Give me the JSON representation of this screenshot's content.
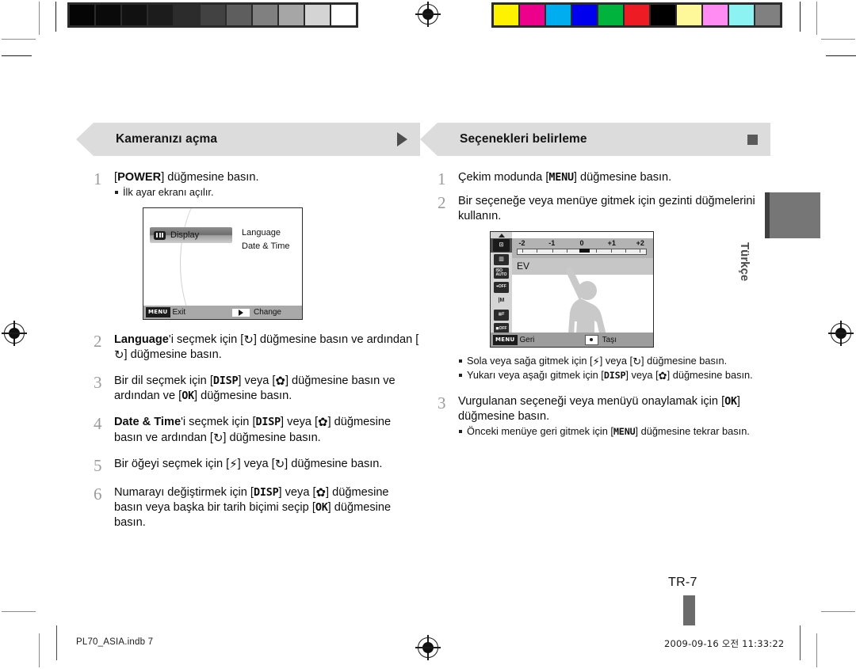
{
  "document": {
    "language_tab": "Türkçe",
    "page_number": "TR-7",
    "footer_file": "PL70_ASIA.indb   7",
    "footer_date": "2009-09-16   오전 11:33:22"
  },
  "calibration": {
    "gray_strip_label": "grayscale-calibration-strip",
    "gray_swatches": [
      "#050505",
      "#0a0a0a",
      "#111111",
      "#1c1c1c",
      "#2c2c2c",
      "#424242",
      "#5e5e5e",
      "#808080",
      "#a6a6a6",
      "#d4d4d4",
      "#ffffff"
    ],
    "color_strip_label": "color-calibration-strip",
    "color_swatches": [
      "#fff200",
      "#ec008c",
      "#00aeef",
      "#0000ee",
      "#00b33c",
      "#ed1c24",
      "#000000",
      "#fff89a",
      "#ff8cf2",
      "#8cf2f2",
      "#808080"
    ]
  },
  "left_section": {
    "heading": "Kameranızı açma",
    "marker": "triangle-right",
    "steps": [
      {
        "num": "1",
        "text_html": "[<b>POWER</b>] düğmesine basın.",
        "bullets": [
          "İlk ayar ekranı açılır."
        ]
      },
      {
        "num": "2",
        "text_html": "<b>Language</b>'i seçmek için [<span class=\"glyph\">↻</span>] düğmesine basın ve ardından [<span class=\"glyph\">↻</span>] düğmesine basın."
      },
      {
        "num": "3",
        "text_html": "Bir dil seçmek için [<span class=\"key\">DISP</span>] veya [<span class=\"glyph\">✿</span>] düğmesine basın ve ardından ve [<span class=\"key\">OK</span>] düğmesine basın."
      },
      {
        "num": "4",
        "text_html": "<b>Date &amp; Time</b>'i seçmek için [<span class=\"key\">DISP</span>] veya [<span class=\"glyph\">✿</span>] düğmesine basın ve ardından [<span class=\"glyph\">↻</span>] düğmesine basın."
      },
      {
        "num": "5",
        "text_html": "Bir öğeyi seçmek için [<span class=\"glyph\">⚡</span>] veya [<span class=\"glyph\">↻</span>] düğmesine basın."
      },
      {
        "num": "6",
        "text_html": "Numarayı değiştirmek için [<span class=\"key\">DISP</span>] veya [<span class=\"glyph\">✿</span>] düğmesine basın veya başka bir tarih biçimi seçip [<span class=\"key\">OK</span>] düğmesine basın."
      }
    ],
    "lcd_setup": {
      "selected_item": "Display",
      "selected_icon": "display-icon",
      "menu_items": [
        "Language",
        "Date & Time"
      ],
      "bottom_bar": {
        "menu_badge": "MENU",
        "left_label": "Exit",
        "arrow_icon": "triangle-right-icon",
        "right_label": "Change"
      }
    }
  },
  "right_section": {
    "heading": "Seçenekleri belirleme",
    "marker": "square",
    "steps": [
      {
        "num": "1",
        "text_html": "Çekim modunda [<span class=\"key\">MENU</span>] düğmesine basın."
      },
      {
        "num": "2",
        "text_html": "Bir seçeneğe veya menüye gitmek için gezinti düğmelerini kullanın.",
        "bullets_html": [
          "Sola veya sağa gitmek için [<span class=\"glyph\">⚡</span>] veya [<span class=\"glyph\">↻</span>] düğmesine basın.",
          "Yukarı veya aşağı gitmek için [<span class=\"key\">DISP</span>] veya [<span class=\"glyph\">✿</span>] düğmesine basın."
        ]
      },
      {
        "num": "3",
        "text_html": "Vurgulanan seçeneği veya menüyü onaylamak için [<span class=\"key\">OK</span>] düğmesine basın.",
        "bullets_html": [
          "Önceki menüye geri gitmek için [<span class=\"key\">MENU</span>] düğmesine tekrar basın."
        ]
      }
    ],
    "lcd_ev": {
      "ev_scale_labels": [
        "-2",
        "-1",
        "0",
        "+1",
        "+2"
      ],
      "ev_value": "0",
      "row_label": "EV",
      "sidebar_icons": [
        "ev-exposure-icon",
        "white-balance-icon",
        "iso-auto-icon",
        "face-detection-off-icon",
        "focus-area-icon",
        "image-quality-icon",
        "flash-off-icon"
      ],
      "bottom_bar": {
        "menu_badge": "MENU",
        "left_label": "Geri",
        "pad_icon": "navigation-pad-icon",
        "right_label": "Taşı"
      }
    }
  }
}
